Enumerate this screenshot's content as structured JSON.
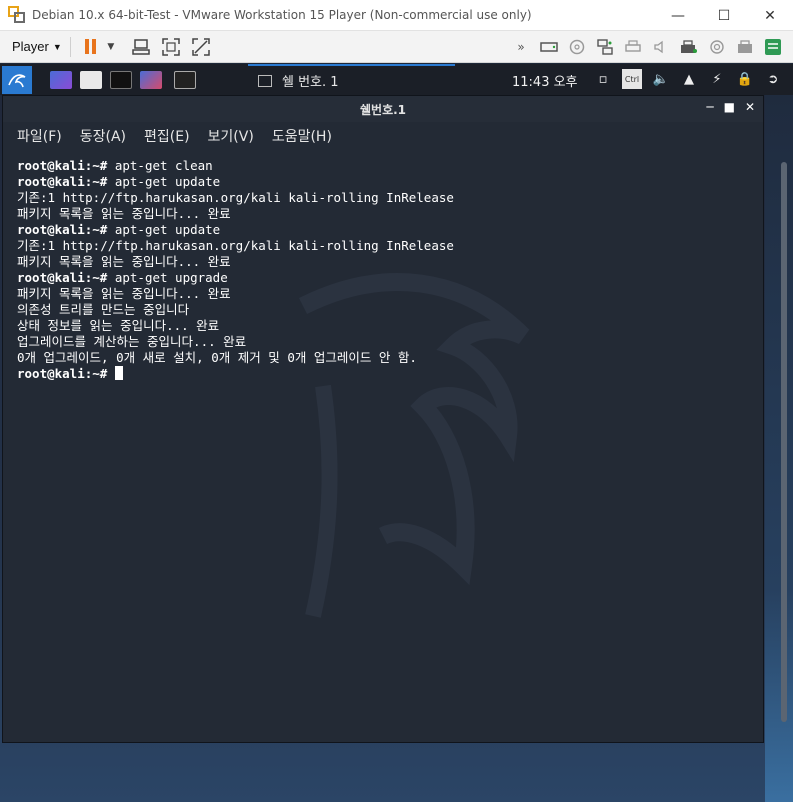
{
  "vmware": {
    "title": "Debian 10.x 64-bit-Test - VMware Workstation 15 Player (Non-commercial use only)",
    "player_menu": "Player",
    "window_controls": [
      "minimize-icon",
      "maximize-icon",
      "close-icon"
    ]
  },
  "kali_panel": {
    "task_label": "쉘 번호. 1",
    "clock": "11:43 오후"
  },
  "terminal": {
    "title": "쉘번호.1",
    "menu": [
      "파일(F)",
      "동장(A)",
      "편집(E)",
      "보기(V)",
      "도움말(H)"
    ],
    "lines": [
      {
        "prompt": "root@kali:~#",
        "text": " apt-get clean"
      },
      {
        "prompt": "root@kali:~#",
        "text": " apt-get update"
      },
      {
        "prompt": "",
        "text": "기존:1 http://ftp.harukasan.org/kali kali-rolling InRelease"
      },
      {
        "prompt": "",
        "text": "패키지 목록을 읽는 중입니다... 완료"
      },
      {
        "prompt": "root@kali:~#",
        "text": " apt-get update"
      },
      {
        "prompt": "",
        "text": "기존:1 http://ftp.harukasan.org/kali kali-rolling InRelease"
      },
      {
        "prompt": "",
        "text": "패키지 목록을 읽는 중입니다... 완료"
      },
      {
        "prompt": "root@kali:~#",
        "text": " apt-get upgrade"
      },
      {
        "prompt": "",
        "text": "패키지 목록을 읽는 중입니다... 완료"
      },
      {
        "prompt": "",
        "text": "의존성 트리를 만드는 중입니다"
      },
      {
        "prompt": "",
        "text": "상태 정보를 읽는 중입니다... 완료"
      },
      {
        "prompt": "",
        "text": "업그레이드를 계산하는 중입니다... 완료"
      },
      {
        "prompt": "",
        "text": "0개 업그레이드, 0개 새로 설치, 0개 제거 및 0개 업그레이드 안 함."
      },
      {
        "prompt": "root@kali:~#",
        "text": " "
      }
    ]
  }
}
